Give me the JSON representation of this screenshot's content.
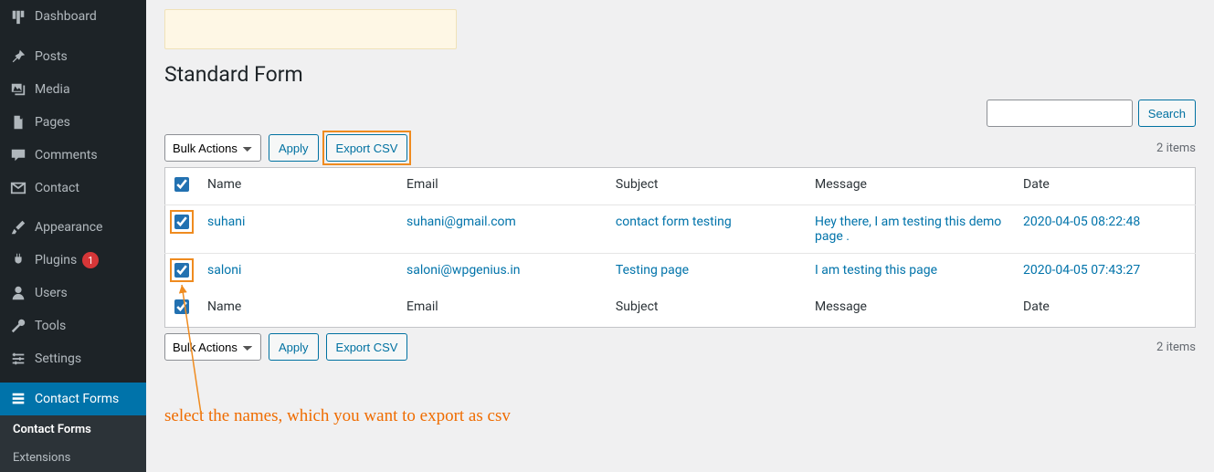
{
  "sidebar": {
    "items": [
      {
        "label": "Dashboard",
        "icon": "dashboard"
      },
      {
        "label": "Posts",
        "icon": "pin"
      },
      {
        "label": "Media",
        "icon": "media"
      },
      {
        "label": "Pages",
        "icon": "page"
      },
      {
        "label": "Comments",
        "icon": "comment"
      },
      {
        "label": "Contact",
        "icon": "mail"
      },
      {
        "label": "Appearance",
        "icon": "brush"
      },
      {
        "label": "Plugins",
        "icon": "plugin",
        "badge": "1"
      },
      {
        "label": "Users",
        "icon": "user"
      },
      {
        "label": "Tools",
        "icon": "wrench"
      },
      {
        "label": "Settings",
        "icon": "settings"
      },
      {
        "label": "Contact Forms",
        "icon": "forms",
        "current": true
      }
    ],
    "submenu": [
      {
        "label": "Contact Forms",
        "active": true
      },
      {
        "label": "Extensions",
        "active": false
      }
    ]
  },
  "page": {
    "title": "Standard Form",
    "search_button": "Search",
    "items_count": "2 items"
  },
  "bulk": {
    "label": "Bulk Actions",
    "apply": "Apply",
    "export": "Export CSV"
  },
  "columns": {
    "name": "Name",
    "email": "Email",
    "subject": "Subject",
    "message": "Message",
    "date": "Date"
  },
  "rows": [
    {
      "name": "suhani",
      "email": "suhani@gmail.com",
      "subject": "contact form testing",
      "message": "Hey there, I am testing this demo page .",
      "date": "2020-04-05 08:22:48"
    },
    {
      "name": "saloni",
      "email": "saloni@wpgenius.in",
      "subject": "Testing page",
      "message": "I am testing this page",
      "date": "2020-04-05 07:43:27"
    }
  ],
  "annotation": {
    "text": "select the names, which you want to export as csv"
  }
}
